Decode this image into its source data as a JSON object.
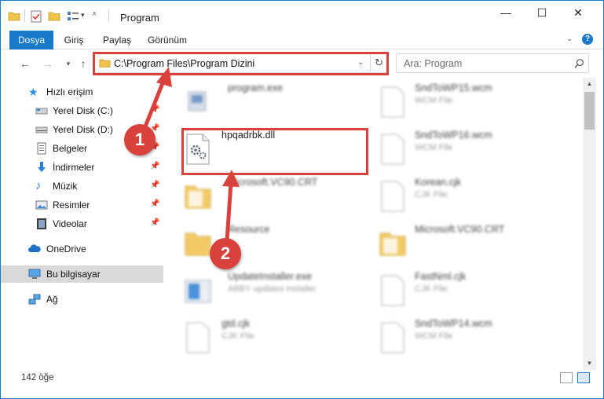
{
  "window": {
    "title": "Program",
    "controls": {
      "minimize": "—",
      "maximize": "☐",
      "close": "✕"
    }
  },
  "ribbon": {
    "tabs": [
      {
        "label": "Dosya",
        "active": true
      },
      {
        "label": "Giriş",
        "active": false
      },
      {
        "label": "Paylaş",
        "active": false
      },
      {
        "label": "Görünüm",
        "active": false
      }
    ],
    "help": "?"
  },
  "address": {
    "path": "C:\\Program Files\\Program Dizini",
    "search_placeholder": "Ara: Program"
  },
  "sidebar": {
    "items": [
      {
        "label": "Hızlı erişim",
        "icon": "star-icon",
        "pinned": false
      },
      {
        "label": "Yerel Disk (C:)",
        "icon": "drive-icon",
        "pinned": true
      },
      {
        "label": "Yerel Disk (D:)",
        "icon": "drive-icon",
        "pinned": true
      },
      {
        "label": "Belgeler",
        "icon": "documents-icon",
        "pinned": true
      },
      {
        "label": "İndirmeler",
        "icon": "download-icon",
        "pinned": true
      },
      {
        "label": "Müzik",
        "icon": "music-icon",
        "pinned": true
      },
      {
        "label": "Resimler",
        "icon": "pictures-icon",
        "pinned": true
      },
      {
        "label": "Videolar",
        "icon": "video-icon",
        "pinned": true
      },
      {
        "label": "OneDrive",
        "icon": "cloud-icon",
        "pinned": false
      },
      {
        "label": "Bu bilgisayar",
        "icon": "computer-icon",
        "pinned": false,
        "selected": true
      },
      {
        "label": "Ağ",
        "icon": "network-icon",
        "pinned": false
      }
    ]
  },
  "files": {
    "left": [
      {
        "name": "program.exe",
        "type": "",
        "icon": "exe-icon"
      },
      {
        "name": "hpqadrbk.dll",
        "type": "",
        "icon": "dll-gear-icon",
        "highlighted": true
      },
      {
        "name": "Microsoft.VC90.CRT",
        "type": "",
        "icon": "folder-icon"
      },
      {
        "name": "Resource",
        "type": "",
        "icon": "folder-icon"
      },
      {
        "name": "UpdateInstaller.exe",
        "type": "ABBY updates installer",
        "icon": "installer-icon"
      },
      {
        "name": "gtd.cjk",
        "type": "CJK File",
        "icon": "file-icon"
      }
    ],
    "right": [
      {
        "name": "SndToWP15.wcm",
        "type": "WCM File",
        "icon": "file-icon"
      },
      {
        "name": "SndToWP16.wcm",
        "type": "WCM File",
        "icon": "file-icon"
      },
      {
        "name": "Korean.cjk",
        "type": "CJK File",
        "icon": "file-icon"
      },
      {
        "name": "Microsoft.VC90.CRT",
        "type": "",
        "icon": "folder-icon"
      },
      {
        "name": "FastNml.cjk",
        "type": "CJK File",
        "icon": "file-icon"
      },
      {
        "name": "SndToWP14.wcm",
        "type": "WCM File",
        "icon": "file-icon"
      }
    ]
  },
  "status": {
    "count": "142 öğe"
  },
  "annotations": {
    "step1": "1",
    "step2": "2",
    "color": "#d9413c"
  },
  "colors": {
    "accent": "#1979ca",
    "selected_nav": "#d9d9d9"
  }
}
